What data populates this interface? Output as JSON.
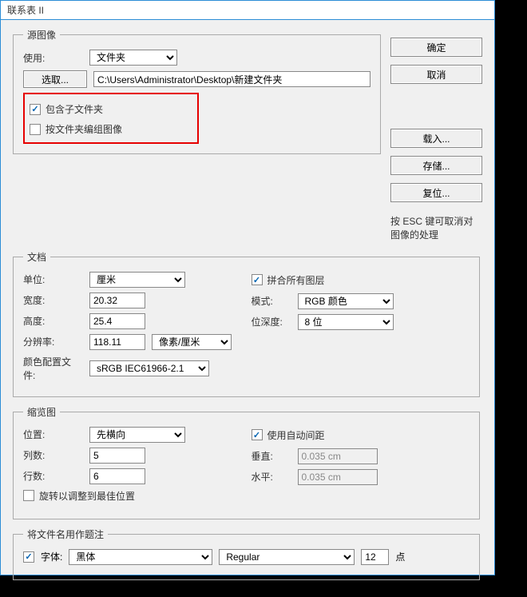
{
  "window": {
    "title": "联系表 II"
  },
  "buttons": {
    "ok": "确定",
    "cancel": "取消",
    "load": "载入...",
    "save": "存储...",
    "reset": "复位..."
  },
  "hint": "按 ESC 键可取消对图像的处理",
  "source": {
    "legend": "源图像",
    "use_label": "使用:",
    "use_value": "文件夹",
    "choose_btn": "选取...",
    "path": "C:\\Users\\Administrator\\Desktop\\新建文件夹",
    "include_sub": "包含子文件夹",
    "group_by_folder": "按文件夹编组图像"
  },
  "document": {
    "legend": "文档",
    "unit_label": "单位:",
    "unit_value": "厘米",
    "width_label": "宽度:",
    "width_value": "20.32",
    "height_label": "高度:",
    "height_value": "25.4",
    "res_label": "分辨率:",
    "res_value": "118.11",
    "res_unit": "像素/厘米",
    "profile_label": "颜色配置文件:",
    "profile_value": "sRGB IEC61966-2.1",
    "flatten_label": "拼合所有图层",
    "mode_label": "模式:",
    "mode_value": "RGB 颜色",
    "depth_label": "位深度:",
    "depth_value": "8 位"
  },
  "thumb": {
    "legend": "缩览图",
    "place_label": "位置:",
    "place_value": "先横向",
    "cols_label": "列数:",
    "cols_value": "5",
    "rows_label": "行数:",
    "rows_value": "6",
    "rotate_label": "旋转以调整到最佳位置",
    "autospace_label": "使用自动间距",
    "v_label": "垂直:",
    "v_value": "0.035 cm",
    "h_label": "水平:",
    "h_value": "0.035 cm"
  },
  "caption": {
    "legend": "将文件名用作题注",
    "font_label": "字体:",
    "font_value": "黑体",
    "style_value": "Regular",
    "size_value": "12",
    "pt_label": "点"
  }
}
